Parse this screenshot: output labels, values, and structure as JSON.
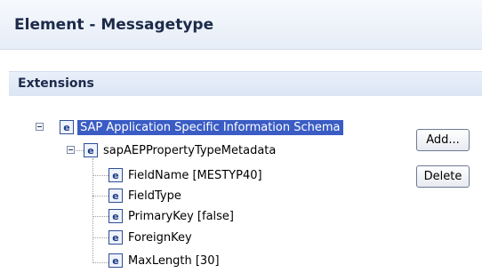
{
  "header": {
    "title": "Element - Messagetype"
  },
  "section": {
    "title": "Extensions"
  },
  "tree": {
    "root": {
      "icon": "element-icon",
      "icon_glyph": "e",
      "label": "SAP Application Specific Information Schema"
    },
    "child": {
      "icon": "element-icon",
      "icon_glyph": "e",
      "label": "sapAEPPropertyTypeMetadata"
    },
    "leaves": [
      {
        "icon": "element-icon",
        "icon_glyph": "e",
        "label": "FieldName [MESTYP40]"
      },
      {
        "icon": "element-icon",
        "icon_glyph": "e",
        "label": "FieldType"
      },
      {
        "icon": "element-icon",
        "icon_glyph": "e",
        "label": "PrimaryKey [false]"
      },
      {
        "icon": "element-icon",
        "icon_glyph": "e",
        "label": "ForeignKey"
      },
      {
        "icon": "element-icon",
        "icon_glyph": "e",
        "label": "MaxLength [30]"
      }
    ]
  },
  "buttons": {
    "add_label": "Add...",
    "delete_label": "Delete"
  },
  "colors": {
    "selection": "#3a5cc4",
    "header_text": "#1c2a4a"
  }
}
